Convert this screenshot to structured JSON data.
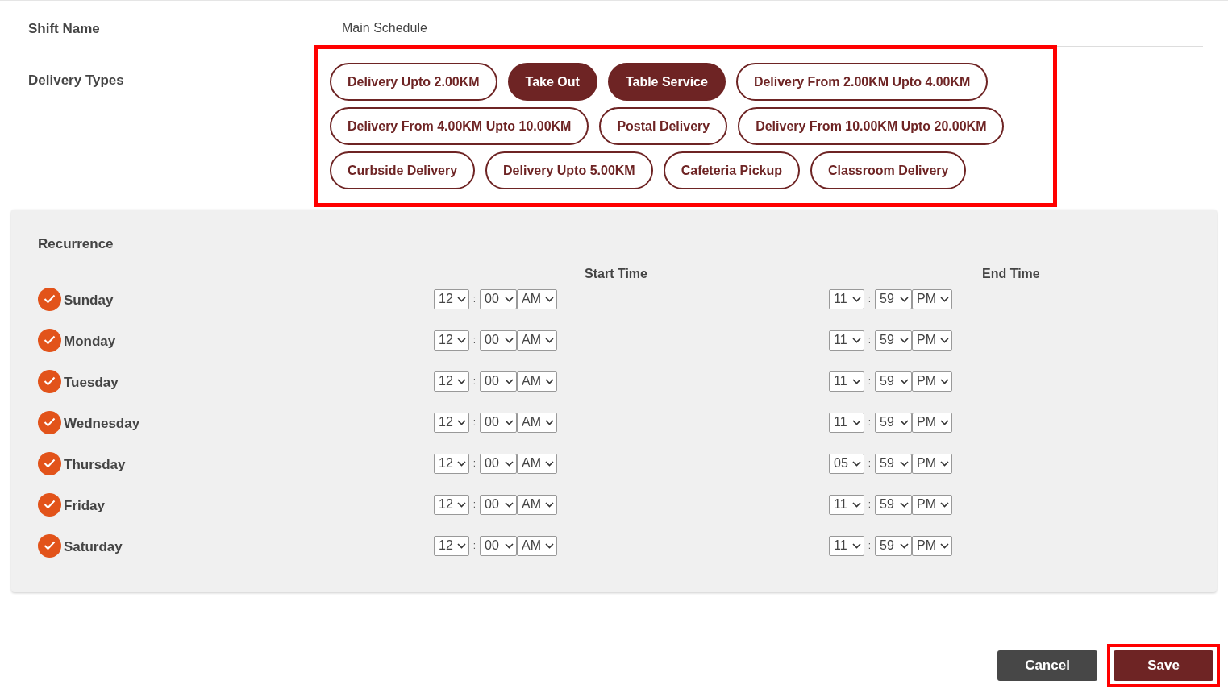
{
  "shift_name": {
    "label": "Shift Name",
    "value": "Main Schedule"
  },
  "delivery_types": {
    "label": "Delivery Types",
    "highlighted": true,
    "options": [
      {
        "label": "Delivery Upto 2.00KM",
        "selected": false
      },
      {
        "label": "Take Out",
        "selected": true
      },
      {
        "label": "Table Service",
        "selected": true
      },
      {
        "label": "Delivery From 2.00KM Upto 4.00KM",
        "selected": false
      },
      {
        "label": "Delivery From 4.00KM Upto 10.00KM",
        "selected": false
      },
      {
        "label": "Postal Delivery",
        "selected": false
      },
      {
        "label": "Delivery From 10.00KM Upto 20.00KM",
        "selected": false
      },
      {
        "label": "Curbside Delivery",
        "selected": false
      },
      {
        "label": "Delivery Upto 5.00KM",
        "selected": false
      },
      {
        "label": "Cafeteria Pickup",
        "selected": false
      },
      {
        "label": "Classroom Delivery",
        "selected": false
      }
    ]
  },
  "recurrence": {
    "title": "Recurrence",
    "start_header": "Start Time",
    "end_header": "End Time",
    "separator": ":",
    "days": [
      {
        "name": "Sunday",
        "checked": true,
        "start": {
          "hour": "12",
          "minute": "00",
          "period": "AM"
        },
        "end": {
          "hour": "11",
          "minute": "59",
          "period": "PM"
        }
      },
      {
        "name": "Monday",
        "checked": true,
        "start": {
          "hour": "12",
          "minute": "00",
          "period": "AM"
        },
        "end": {
          "hour": "11",
          "minute": "59",
          "period": "PM"
        }
      },
      {
        "name": "Tuesday",
        "checked": true,
        "start": {
          "hour": "12",
          "minute": "00",
          "period": "AM"
        },
        "end": {
          "hour": "11",
          "minute": "59",
          "period": "PM"
        }
      },
      {
        "name": "Wednesday",
        "checked": true,
        "start": {
          "hour": "12",
          "minute": "00",
          "period": "AM"
        },
        "end": {
          "hour": "11",
          "minute": "59",
          "period": "PM"
        }
      },
      {
        "name": "Thursday",
        "checked": true,
        "start": {
          "hour": "12",
          "minute": "00",
          "period": "AM"
        },
        "end": {
          "hour": "05",
          "minute": "59",
          "period": "PM"
        }
      },
      {
        "name": "Friday",
        "checked": true,
        "start": {
          "hour": "12",
          "minute": "00",
          "period": "AM"
        },
        "end": {
          "hour": "11",
          "minute": "59",
          "period": "PM"
        }
      },
      {
        "name": "Saturday",
        "checked": true,
        "start": {
          "hour": "12",
          "minute": "00",
          "period": "AM"
        },
        "end": {
          "hour": "11",
          "minute": "59",
          "period": "PM"
        }
      }
    ]
  },
  "buttons": [
    {
      "kind": "cancel",
      "label": "Cancel",
      "highlighted": false
    },
    {
      "kind": "save",
      "label": "Save",
      "highlighted": true
    }
  ]
}
